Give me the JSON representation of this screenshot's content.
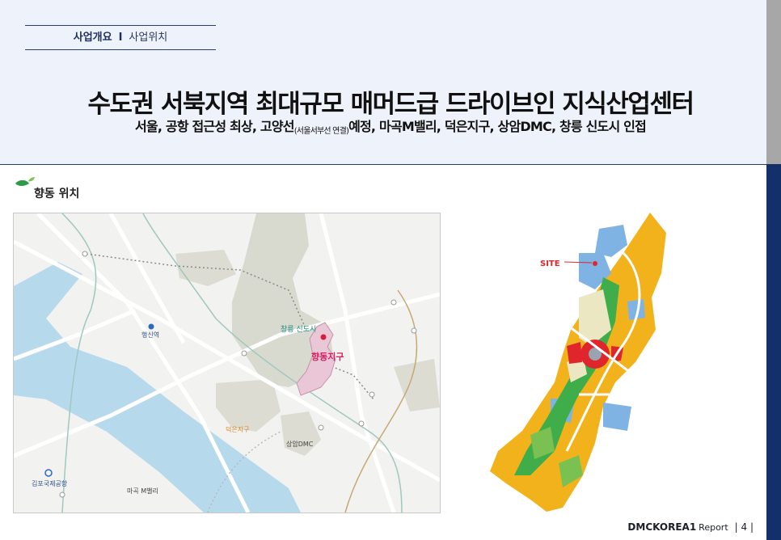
{
  "breadcrumb": {
    "primary": "사업개요",
    "separator": "I",
    "secondary": "사업위치"
  },
  "title": "수도권 서북지역 최대규모 매머드급 드라이브인 지식산업센터",
  "subtitle": {
    "part1": "서울, 공항 접근성 최상, 고양선",
    "small": "(서울서부선 연결)",
    "part2": "예정, 마곡M밸리, 덕은지구, 상암DMC, 창릉 신도시 인접"
  },
  "section": {
    "label": "향동 위치",
    "icon": "leaf-icon"
  },
  "map": {
    "labels": {
      "changneung": "창릉 신도시",
      "hyangdong": "향동지구",
      "haengsin": "행신역",
      "deokeun": "덕은지구",
      "sangam": "상암DMC",
      "gimpo": "김포국제공항",
      "magok": "마곡 M밸리"
    }
  },
  "site_map": {
    "site_label": "SITE"
  },
  "footer": {
    "brand": "DMCKOREA1",
    "report": "Report",
    "page": "| 4 |"
  },
  "colors": {
    "navy": "#13306b",
    "accent_red": "#e0252c",
    "yellow": "#f2b21c",
    "green": "#3fae4a",
    "blue": "#7fb3e3"
  }
}
